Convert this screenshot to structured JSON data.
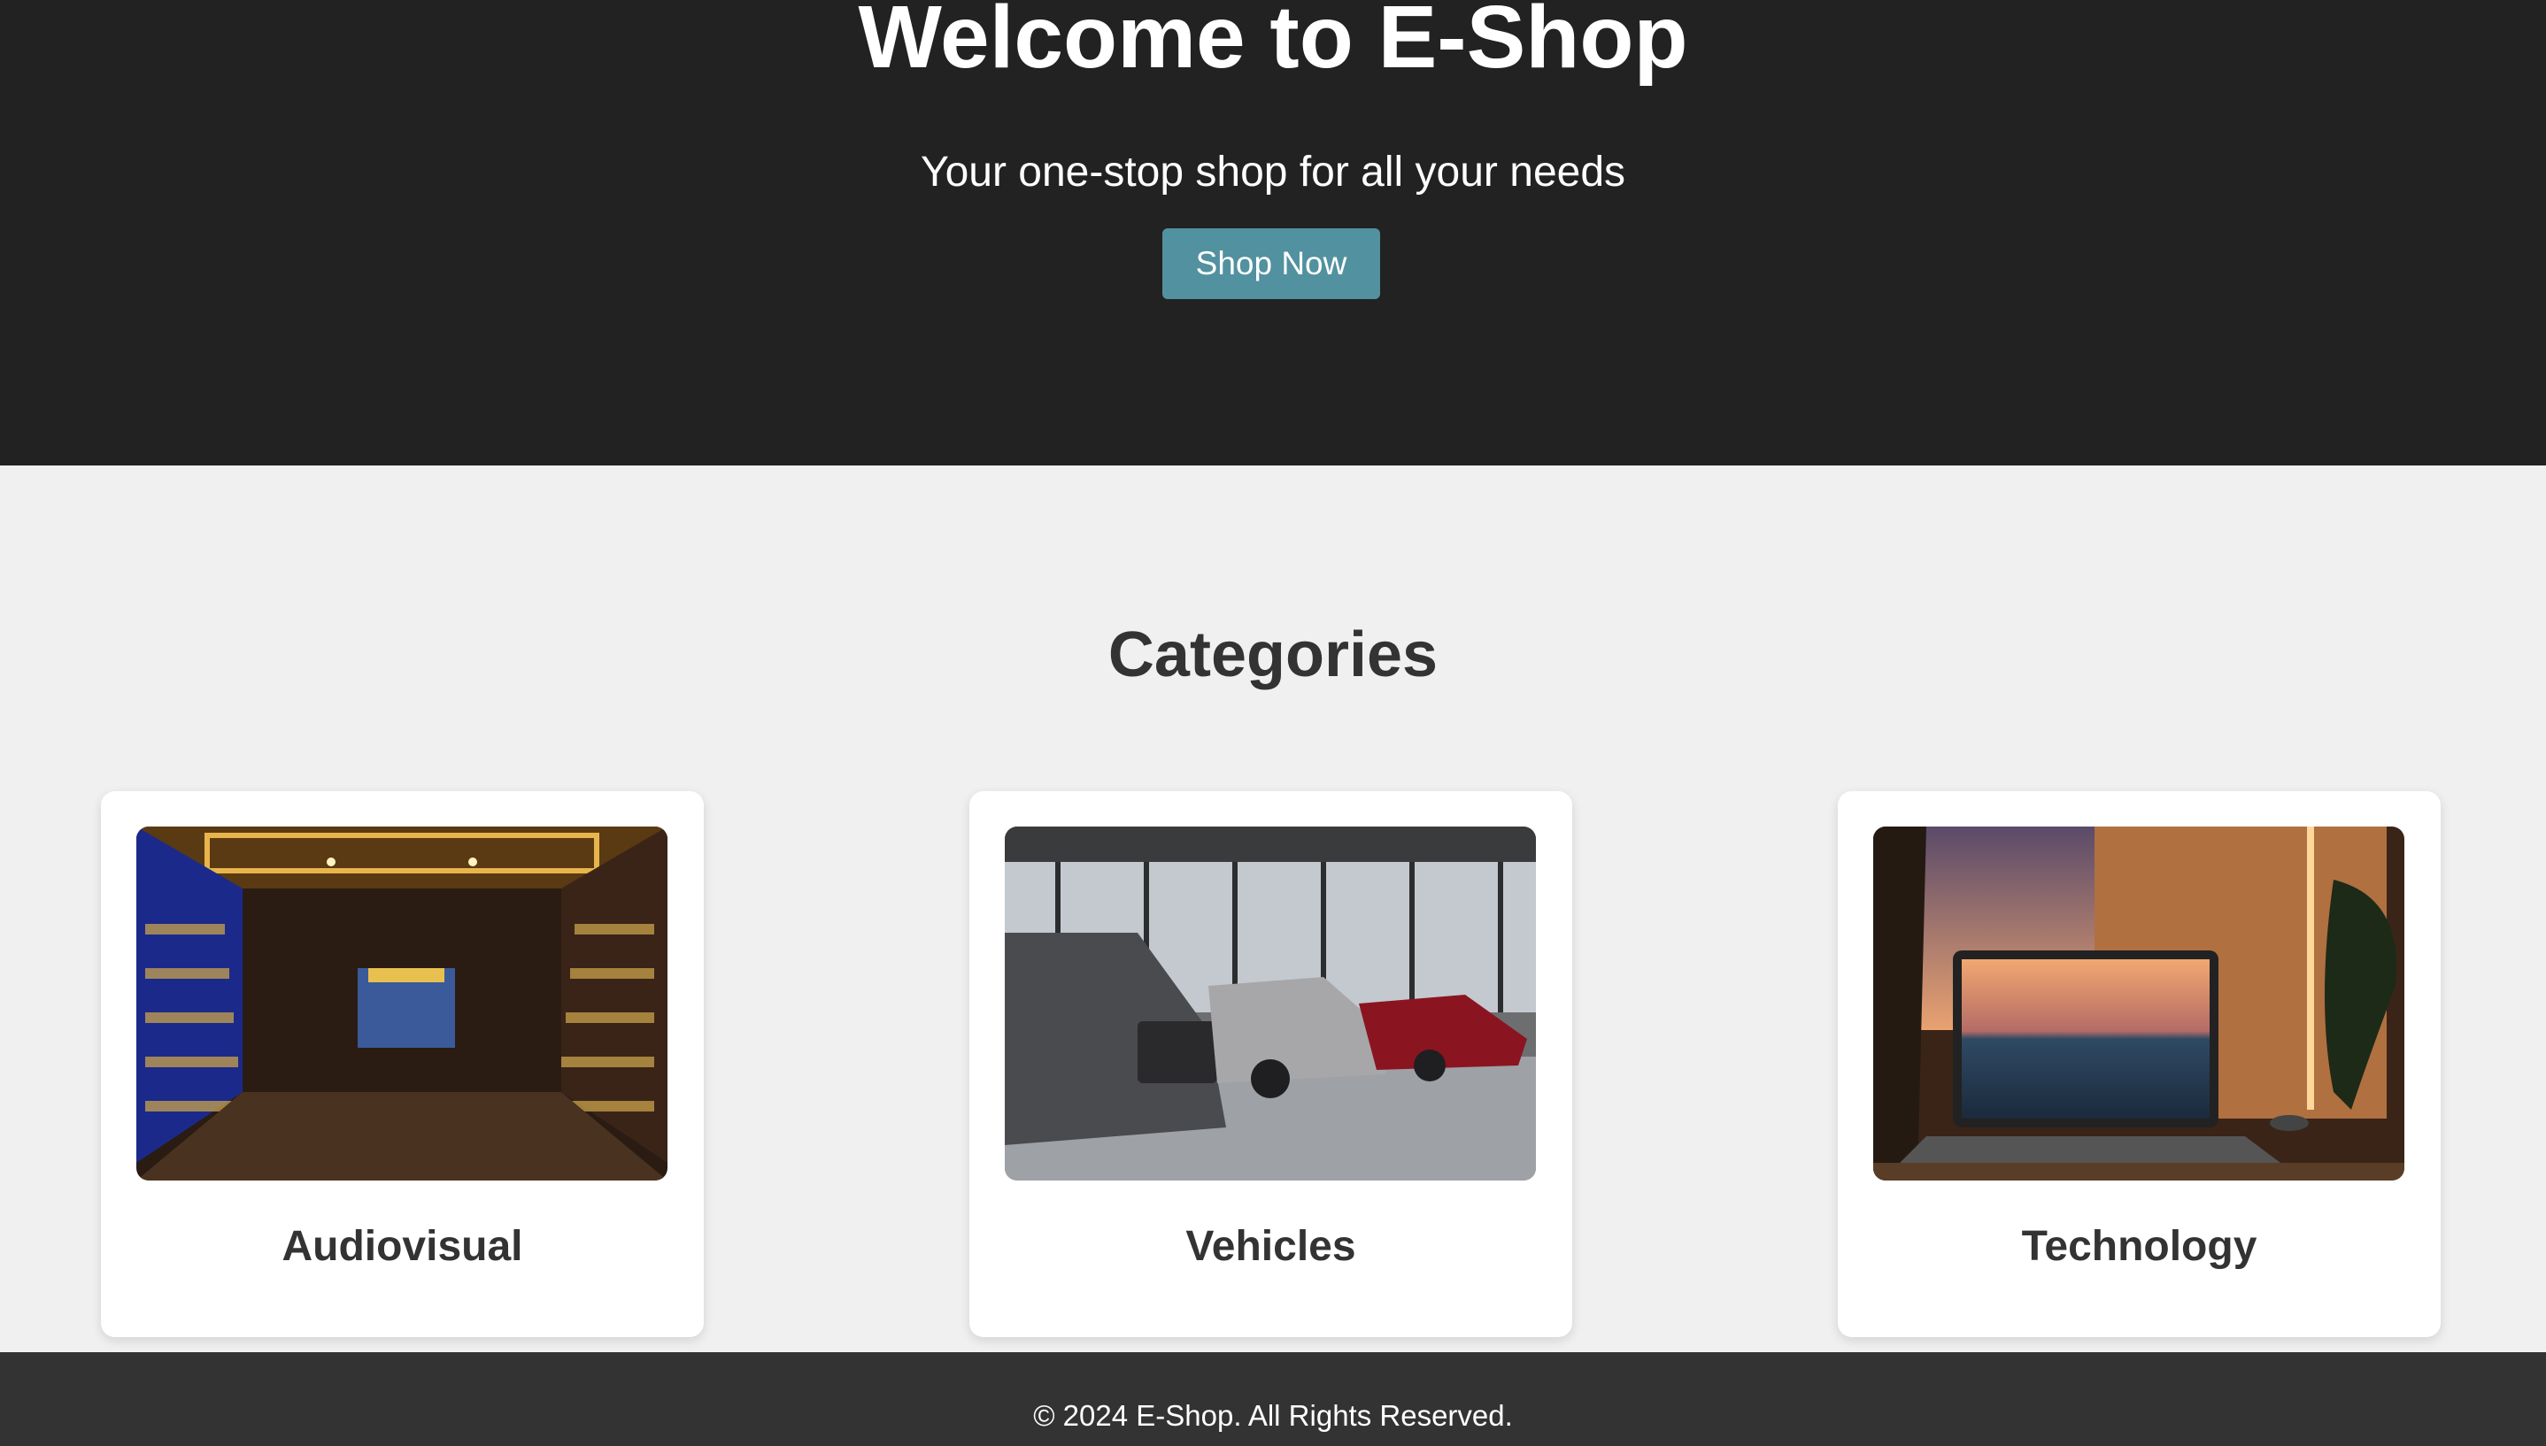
{
  "hero": {
    "title": "Welcome to E-Shop",
    "subtitle": "Your one-stop shop for all your needs",
    "button_label": "Shop Now"
  },
  "categories": {
    "title": "Categories",
    "items": [
      {
        "label": "Audiovisual"
      },
      {
        "label": "Vehicles"
      },
      {
        "label": "Technology"
      }
    ]
  },
  "footer": {
    "text": "© 2024 E-Shop. All Rights Reserved."
  },
  "colors": {
    "hero_bg": "#222222",
    "accent": "#52919f",
    "page_bg": "#f0f0f0",
    "footer_bg": "#333333",
    "text_dark": "#333333"
  }
}
